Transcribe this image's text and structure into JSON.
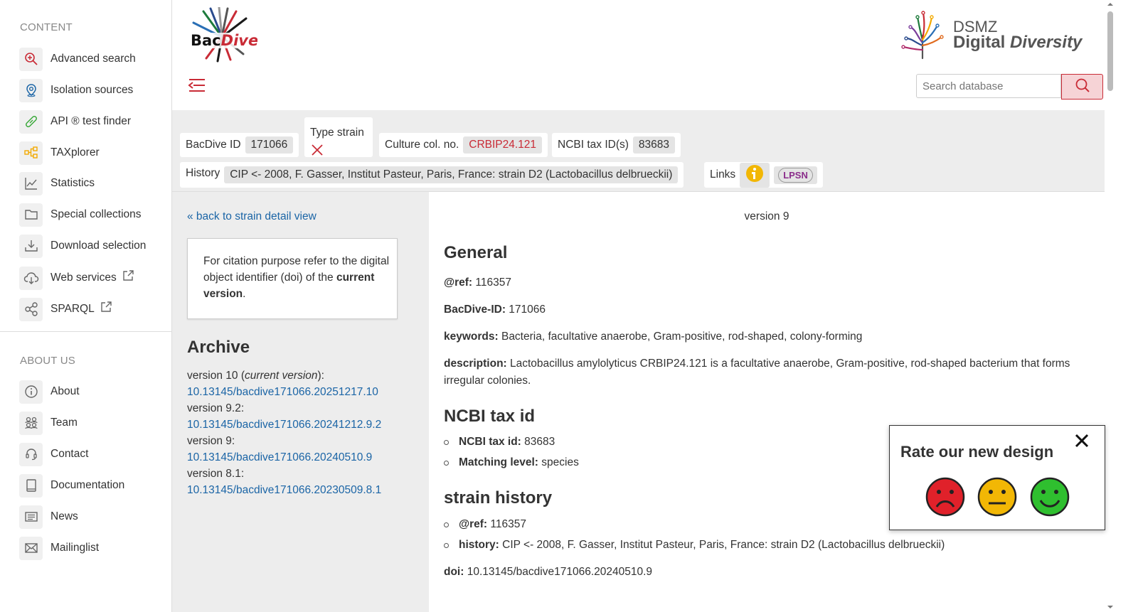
{
  "sidebar": {
    "content_title": "CONTENT",
    "content_items": [
      {
        "label": "Advanced search",
        "icon": "magnifier-plus-icon"
      },
      {
        "label": "Isolation sources",
        "icon": "map-pin-icon"
      },
      {
        "label": "API ® test finder",
        "icon": "test-tube-icon"
      },
      {
        "label": "TAXplorer",
        "icon": "hierarchy-icon"
      },
      {
        "label": "Statistics",
        "icon": "line-chart-icon"
      },
      {
        "label": "Special collections",
        "icon": "folder-icon"
      },
      {
        "label": "Download selection",
        "icon": "download-icon"
      },
      {
        "label": "Web services",
        "icon": "cloud-download-icon"
      },
      {
        "label": "SPARQL",
        "icon": "share-nodes-icon"
      }
    ],
    "about_title": "ABOUT US",
    "about_items": [
      {
        "label": "About",
        "icon": "info-icon"
      },
      {
        "label": "Team",
        "icon": "people-icon"
      },
      {
        "label": "Contact",
        "icon": "headset-icon"
      },
      {
        "label": "Documentation",
        "icon": "book-icon"
      },
      {
        "label": "News",
        "icon": "newspaper-icon"
      },
      {
        "label": "Mailinglist",
        "icon": "envelope-icon"
      }
    ]
  },
  "header": {
    "logo_text": "BacDive",
    "dsmz_line1": "DSMZ",
    "dsmz_line2a": "Digital ",
    "dsmz_line2b": "Diversity",
    "search_placeholder": "Search database"
  },
  "strain": {
    "bacdive_id_label": "BacDive ID",
    "bacdive_id": "171066",
    "type_strain_label": "Type strain",
    "culture_label": "Culture col. no.",
    "culture_value": "CRBIP24.121",
    "ncbi_label": "NCBI tax ID(s)",
    "ncbi_value": "83683",
    "history_label": "History",
    "history_value": "CIP <- 2008, F. Gasser, Institut Pasteur, Paris, France: strain D2 (Lactobacillus delbrueckii)",
    "links_label": "Links",
    "lpsn_label": "LPSN"
  },
  "left": {
    "back_link": "« back to strain detail view",
    "cite_text_1": "For citation purpose refer to the digital object identifier (doi) of the ",
    "cite_text_bold": "current version",
    "cite_text_end": ".",
    "archive_title": "Archive",
    "versions": [
      {
        "label_a": "version 10 (",
        "label_i": "current version",
        "label_b": "):",
        "doi": "10.13145/bacdive171066.20251217.10"
      },
      {
        "label_a": "version 9.2:",
        "label_i": "",
        "label_b": "",
        "doi": "10.13145/bacdive171066.20241212.9.2"
      },
      {
        "label_a": "version 9:",
        "label_i": "",
        "label_b": "",
        "doi": "10.13145/bacdive171066.20240510.9"
      },
      {
        "label_a": "version 8.1:",
        "label_i": "",
        "label_b": "",
        "doi": "10.13145/bacdive171066.20230509.8.1"
      }
    ]
  },
  "main": {
    "version": "version 9",
    "general_title": "General",
    "ref_label": "@ref:",
    "ref_value": " 116357",
    "bacdive_label": "BacDive-ID:",
    "bacdive_value": " 171066",
    "keywords_label": "keywords:",
    "keywords_value": " Bacteria, facultative anaerobe, Gram-positive, rod-shaped, colony-forming",
    "description_label": "description:",
    "description_value": " Lactobacillus amylolyticus CRBIP24.121 is a facultative anaerobe, Gram-positive, rod-shaped bacterium that forms irregular colonies.",
    "ncbi_title": "NCBI tax id",
    "ncbi_taxid_label": "NCBI tax id:",
    "ncbi_taxid_value": " 83683",
    "matching_label": "Matching level:",
    "matching_value": " species",
    "history_title": "strain history",
    "hist_ref_label": "@ref:",
    "hist_ref_value": " 116357",
    "hist_label": "history:",
    "hist_value": " CIP <- 2008, F. Gasser, Institut Pasteur, Paris, France: strain D2 (Lactobacillus delbrueckii)",
    "doi_label": "doi:",
    "doi_value": " 10.13145/bacdive171066.20240510.9"
  },
  "rating": {
    "title": "Rate our new design"
  },
  "colors": {
    "accent_red": "#c92b36",
    "link_blue": "#1b65a6",
    "face_bad": "#e0212a",
    "face_neutral": "#f2b705",
    "face_good": "#2fbf2f"
  }
}
